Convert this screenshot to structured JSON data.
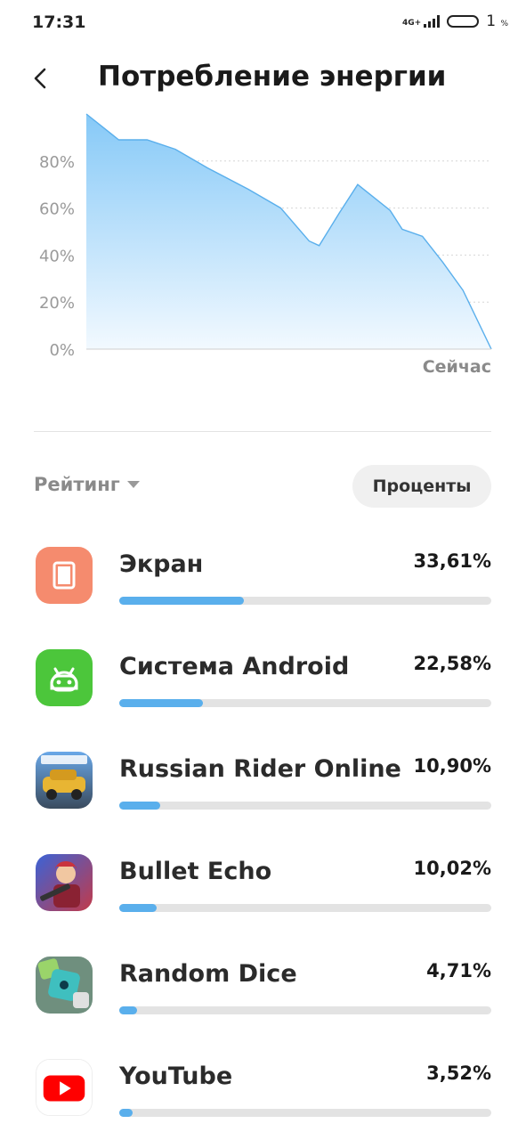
{
  "status": {
    "time": "17:31",
    "network": "4G+",
    "battery_value": "1",
    "battery_unit": "%"
  },
  "header": {
    "title": "Потребление энергии"
  },
  "chart_data": {
    "type": "area",
    "ylabel": "",
    "xlabel": "",
    "y_ticks": [
      "80%",
      "60%",
      "40%",
      "20%",
      "0%"
    ],
    "x_label_end": "Сейчас",
    "ylim": [
      0,
      100
    ],
    "fill_color": "#8ecdf8",
    "line_color": "#5aafec",
    "x": [
      0,
      0.08,
      0.15,
      0.22,
      0.3,
      0.4,
      0.48,
      0.55,
      0.575,
      0.625,
      0.67,
      0.75,
      0.78,
      0.83,
      0.88,
      0.93,
      1.0
    ],
    "values": [
      100,
      89,
      89,
      85,
      77,
      68,
      60,
      46,
      44,
      58,
      70,
      59,
      51,
      48,
      37,
      25,
      0
    ]
  },
  "controls": {
    "sort_label": "Рейтинг",
    "mode_label": "Проценты"
  },
  "apps": [
    {
      "name": "Экран",
      "percent_text": "33,61%",
      "fraction": 0.3361,
      "icon": "screen-icon",
      "icon_bg": "#f58b6e"
    },
    {
      "name": "Система Android",
      "percent_text": "22,58%",
      "fraction": 0.2258,
      "icon": "android-icon",
      "icon_bg": "#4cc63b"
    },
    {
      "name": "Russian Rider Online",
      "percent_text": "10,90%",
      "fraction": 0.109,
      "icon": "game-car-icon",
      "icon_bg": "#3a6fb0"
    },
    {
      "name": "Bullet Echo",
      "percent_text": "10,02%",
      "fraction": 0.1002,
      "icon": "game-soldier-icon",
      "icon_bg": "#3b63d6"
    },
    {
      "name": "Random Dice",
      "percent_text": "4,71%",
      "fraction": 0.0471,
      "icon": "game-dice-icon",
      "icon_bg": "#7fb8a0"
    },
    {
      "name": "YouTube",
      "percent_text": "3,52%",
      "fraction": 0.0352,
      "icon": "youtube-icon",
      "icon_bg": "#ffffff"
    }
  ]
}
